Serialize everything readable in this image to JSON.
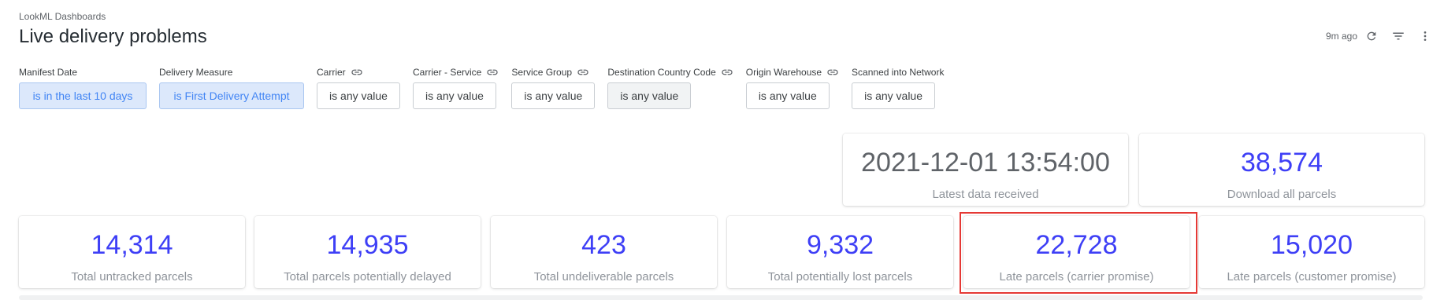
{
  "header": {
    "breadcrumb": "LookML Dashboards",
    "title": "Live delivery problems",
    "last_updated": "9m ago",
    "icons": [
      "refresh-icon",
      "filter-icon",
      "more-vert-icon"
    ]
  },
  "filters": [
    {
      "label": "Manifest Date",
      "value": "is in the last 10 days",
      "linked": false,
      "state": "active"
    },
    {
      "label": "Delivery Measure",
      "value": "is First Delivery Attempt",
      "linked": false,
      "state": "active"
    },
    {
      "label": "Carrier",
      "value": "is any value",
      "linked": true,
      "state": "default"
    },
    {
      "label": "Carrier - Service",
      "value": "is any value",
      "linked": true,
      "state": "default"
    },
    {
      "label": "Service Group",
      "value": "is any value",
      "linked": true,
      "state": "default"
    },
    {
      "label": "Destination Country Code",
      "value": "is any value",
      "linked": true,
      "state": "greyed"
    },
    {
      "label": "Origin Warehouse",
      "value": "is any value",
      "linked": true,
      "state": "default"
    },
    {
      "label": "Scanned into Network",
      "value": "is any value",
      "linked": false,
      "state": "default"
    }
  ],
  "top_tiles": [
    {
      "value": "2021-12-01 13:54:00",
      "label": "Latest data received"
    },
    {
      "value": "38,574",
      "label": "Download all parcels"
    }
  ],
  "kpi_tiles": [
    {
      "value": "14,314",
      "label": "Total untracked parcels"
    },
    {
      "value": "14,935",
      "label": "Total parcels potentially delayed"
    },
    {
      "value": "423",
      "label": "Total undeliverable parcels"
    },
    {
      "value": "9,332",
      "label": "Total potentially lost parcels"
    },
    {
      "value": "22,728",
      "label": "Late parcels (carrier promise)",
      "highlighted": true
    },
    {
      "value": "15,020",
      "label": "Late parcels (customer promise)"
    }
  ],
  "colors": {
    "accent_value": "#3e3ff6",
    "active_filter_bg": "#dce8fb",
    "active_filter_text": "#4285f4",
    "highlight": "#e53935"
  }
}
